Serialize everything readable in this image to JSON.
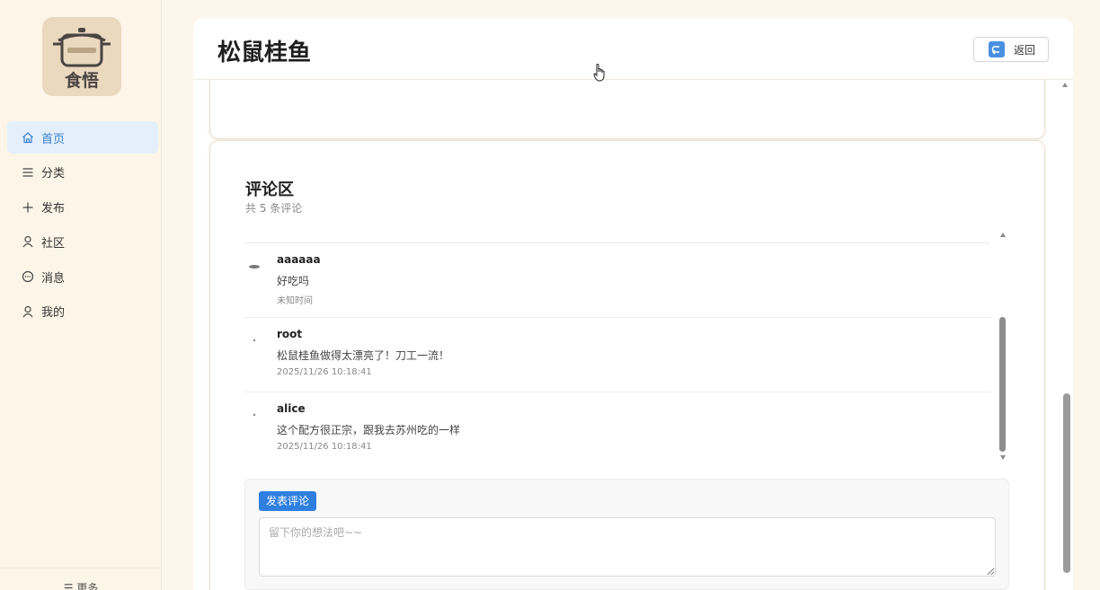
{
  "sidebar": {
    "logo_text": "食悟",
    "items": [
      {
        "label": "首页",
        "icon": "home-icon",
        "active": true
      },
      {
        "label": "分类",
        "icon": "menu-icon",
        "active": false
      },
      {
        "label": "发布",
        "icon": "plus-icon",
        "active": false
      },
      {
        "label": "社区",
        "icon": "user-icon",
        "active": false
      },
      {
        "label": "消息",
        "icon": "chat-icon",
        "active": false
      },
      {
        "label": "我的",
        "icon": "user-icon",
        "active": false
      }
    ],
    "more_label": "更多"
  },
  "header": {
    "title": "松鼠桂鱼",
    "back_label": "返回"
  },
  "comments_section": {
    "title": "评论区",
    "count_text": "共 5 条评论",
    "comments": [
      {
        "user": "aaaaaa",
        "content": "好吃吗",
        "time": "未知时间"
      },
      {
        "user": "root",
        "content": "松鼠桂鱼做得太漂亮了！刀工一流！",
        "time": "2025/11/26 10:18:41"
      },
      {
        "user": "alice",
        "content": "这个配方很正宗，跟我去苏州吃的一样",
        "time": "2025/11/26 10:18:41"
      }
    ]
  },
  "composer": {
    "publish_label": "发表评论",
    "placeholder": "留下你的想法吧~~",
    "value": ""
  },
  "colors": {
    "accent": "#2f7fe0",
    "nav_active_bg": "#e3f0fb",
    "page_bg": "#fdf6ea"
  }
}
